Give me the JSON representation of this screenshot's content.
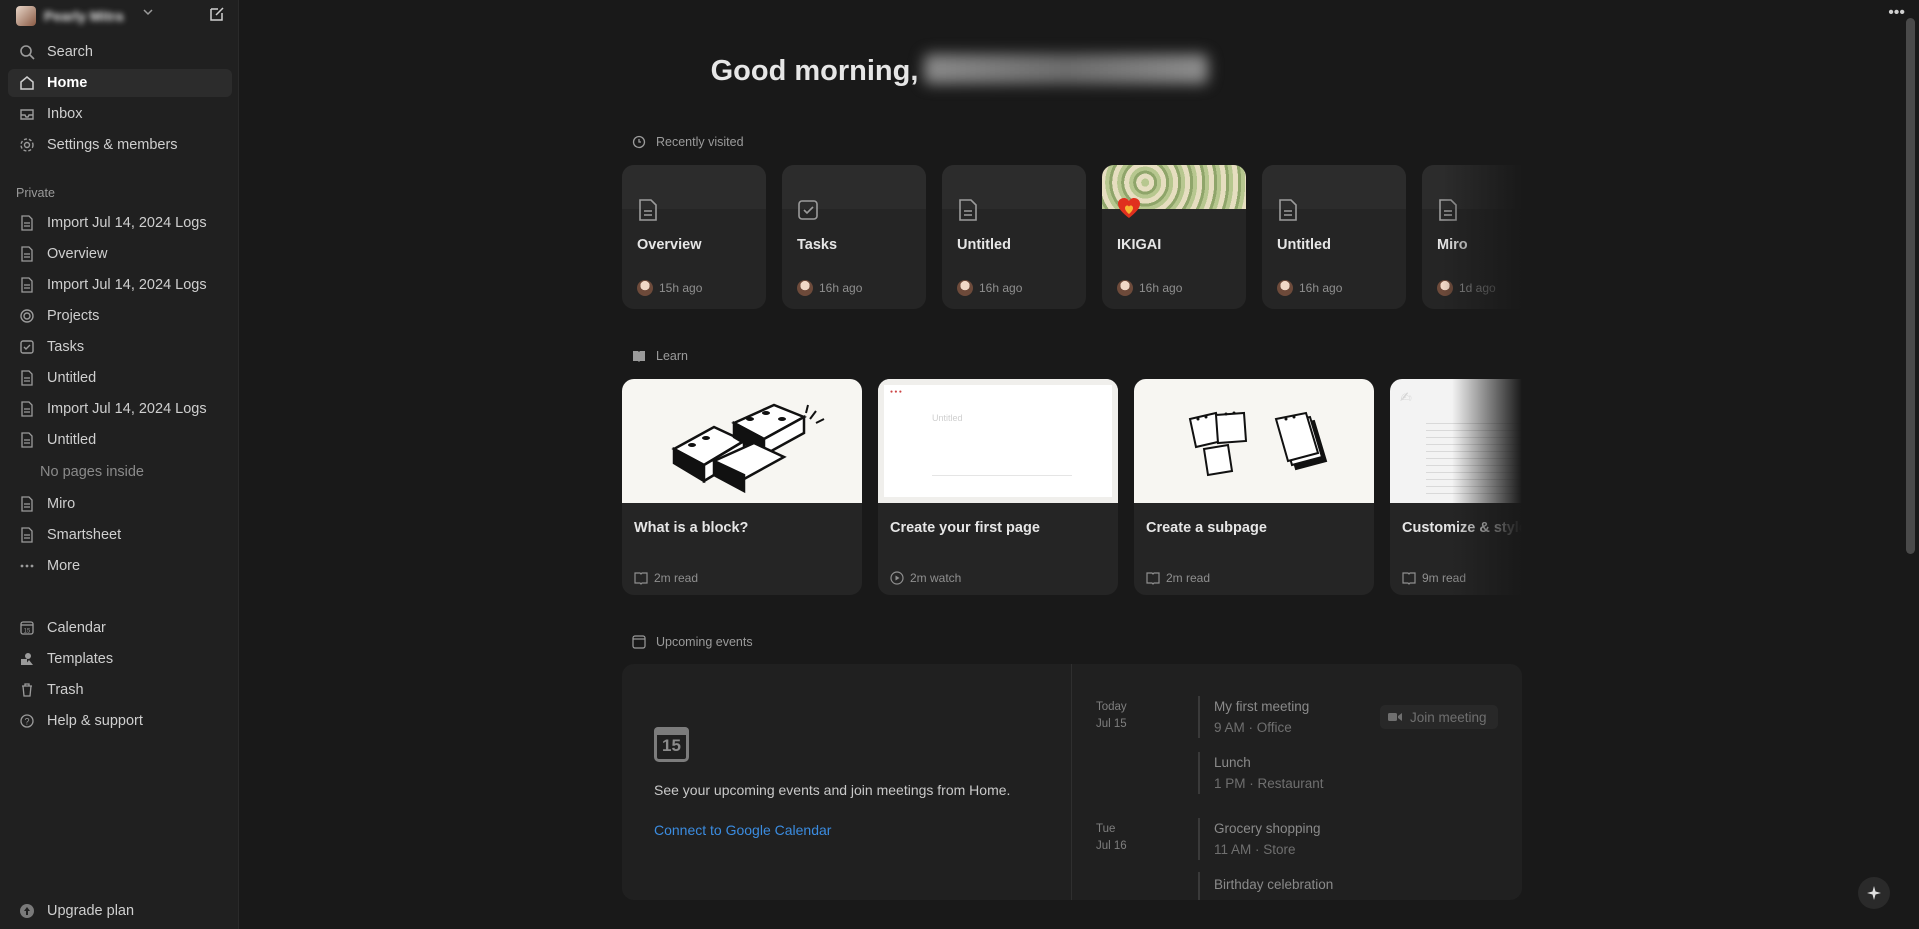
{
  "workspace": {
    "name": "Pearly Mitra"
  },
  "sidebar": {
    "top": [
      {
        "label": "Search",
        "icon": "search-icon"
      },
      {
        "label": "Home",
        "icon": "home-icon",
        "active": true
      },
      {
        "label": "Inbox",
        "icon": "inbox-icon"
      },
      {
        "label": "Settings & members",
        "icon": "gear-icon"
      }
    ],
    "private_label": "Private",
    "pages": [
      {
        "label": "Import Jul 14, 2024 Logs",
        "icon": "page-icon"
      },
      {
        "label": "Overview",
        "icon": "page-icon"
      },
      {
        "label": "Import Jul 14, 2024 Logs",
        "icon": "page-icon"
      },
      {
        "label": "Projects",
        "icon": "target-icon"
      },
      {
        "label": "Tasks",
        "icon": "checkbox-icon"
      },
      {
        "label": "Untitled",
        "icon": "page-icon"
      },
      {
        "label": "Import Jul 14, 2024 Logs",
        "icon": "page-icon"
      },
      {
        "label": "Untitled",
        "icon": "page-icon"
      }
    ],
    "no_pages_inside": "No pages inside",
    "pages2": [
      {
        "label": "Miro",
        "icon": "page-icon"
      },
      {
        "label": "Smartsheet",
        "icon": "page-icon"
      },
      {
        "label": "More",
        "icon": "more-icon"
      }
    ],
    "bottom": [
      {
        "label": "Calendar",
        "icon": "calendar-icon"
      },
      {
        "label": "Templates",
        "icon": "templates-icon"
      },
      {
        "label": "Trash",
        "icon": "trash-icon"
      },
      {
        "label": "Help & support",
        "icon": "help-icon"
      }
    ],
    "upgrade": {
      "label": "Upgrade plan",
      "icon": "upgrade-icon"
    }
  },
  "main": {
    "greeting": "Good morning,",
    "recently_visited": {
      "heading": "Recently visited",
      "cards": [
        {
          "title": "Overview",
          "time": "15h ago",
          "icon": "page-icon"
        },
        {
          "title": "Tasks",
          "time": "16h ago",
          "icon": "checkbox-icon"
        },
        {
          "title": "Untitled",
          "time": "16h ago",
          "icon": "page-icon"
        },
        {
          "title": "IKIGAI",
          "time": "16h ago",
          "icon": "heart-icon"
        },
        {
          "title": "Untitled",
          "time": "16h ago",
          "icon": "page-icon"
        },
        {
          "title": "Miro",
          "time": "1d ago",
          "icon": "page-icon"
        }
      ]
    },
    "learn": {
      "heading": "Learn",
      "cards": [
        {
          "title": "What is a block?",
          "meta": "2m read",
          "meta_icon": "book-icon"
        },
        {
          "title": "Create your first page",
          "meta": "2m watch",
          "meta_icon": "play-icon"
        },
        {
          "title": "Create a subpage",
          "meta": "2m read",
          "meta_icon": "book-icon"
        },
        {
          "title": "Customize & style content",
          "meta": "9m read",
          "meta_icon": "book-icon"
        }
      ],
      "screenshot_title": "Untitled"
    },
    "upcoming": {
      "heading": "Upcoming events",
      "calendar_number": "15",
      "description": "See your upcoming events and join meetings from Home.",
      "connect_link": "Connect to Google Calendar",
      "days": [
        {
          "day": "Today",
          "date": "Jul 15"
        },
        {
          "day": "Tue",
          "date": "Jul 16"
        }
      ],
      "events": [
        {
          "title": "My first meeting",
          "detail": "9 AM · Office"
        },
        {
          "title": "Lunch",
          "detail": "1 PM · Restaurant"
        },
        {
          "title": "Grocery shopping",
          "detail": "11 AM · Store"
        },
        {
          "title": "Birthday celebration",
          "detail": ""
        }
      ],
      "join_label": "Join meeting"
    }
  }
}
